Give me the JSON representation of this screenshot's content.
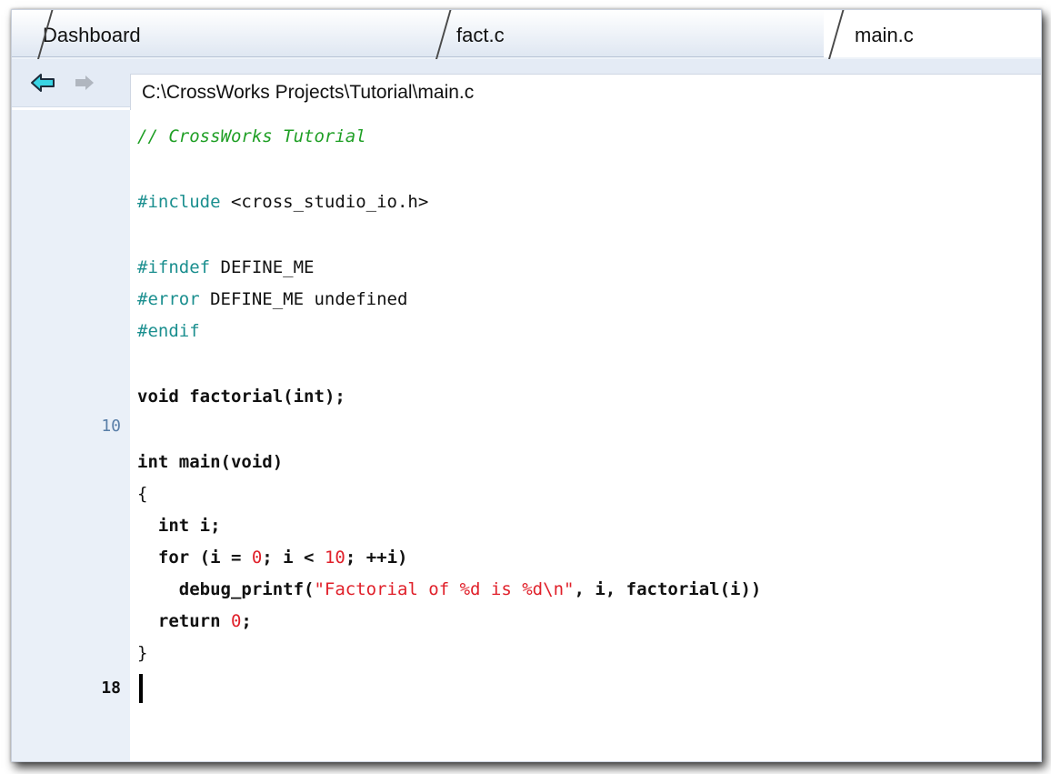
{
  "tabs": [
    {
      "label": "Dashboard",
      "active": false
    },
    {
      "label": "fact.c",
      "active": false
    },
    {
      "label": "main.c",
      "active": true
    }
  ],
  "nav": {
    "back_icon": "back-arrow-icon",
    "forward_icon": "forward-arrow-icon",
    "path": "C:\\CrossWorks Projects\\Tutorial\\main.c"
  },
  "line_numbers": {
    "line10": "10",
    "line18": "18"
  },
  "code": {
    "l1": "// CrossWorks Tutorial",
    "l3_directive": "#include",
    "l3_rest": " <cross_studio_io.h>",
    "l5_directive": "#ifndef",
    "l5_rest": " DEFINE_ME",
    "l6_directive": "#error",
    "l6_rest": " DEFINE_ME undefined",
    "l7_directive": "#endif",
    "l9_kw": "void",
    "l9_fn": " factorial(",
    "l9_kw2": "int",
    "l9_end": ");",
    "l11_kw": "int",
    "l11_fn": " main(",
    "l11_kw2": "void",
    "l11_end": ")",
    "l12": "{",
    "l13_kw": "  int",
    "l13_rest": " i;",
    "l14_kw": "  for",
    "l14_a": " (i = ",
    "l14_n1": "0",
    "l14_b": "; i < ",
    "l14_n2": "10",
    "l14_c": "; ++i)",
    "l15_fn": "    debug_printf(",
    "l15_str": "\"Factorial of %d is %d\\n\"",
    "l15_rest": ", i, factorial(i))",
    "l16_kw": "  return",
    "l16_sp": " ",
    "l16_n": "0",
    "l16_end": ";",
    "l17": "}"
  },
  "colors": {
    "comment": "#1f9f25",
    "preprocessor": "#1b8f8f",
    "literal": "#e0202a",
    "gutter_number": "#5a7fa8"
  }
}
